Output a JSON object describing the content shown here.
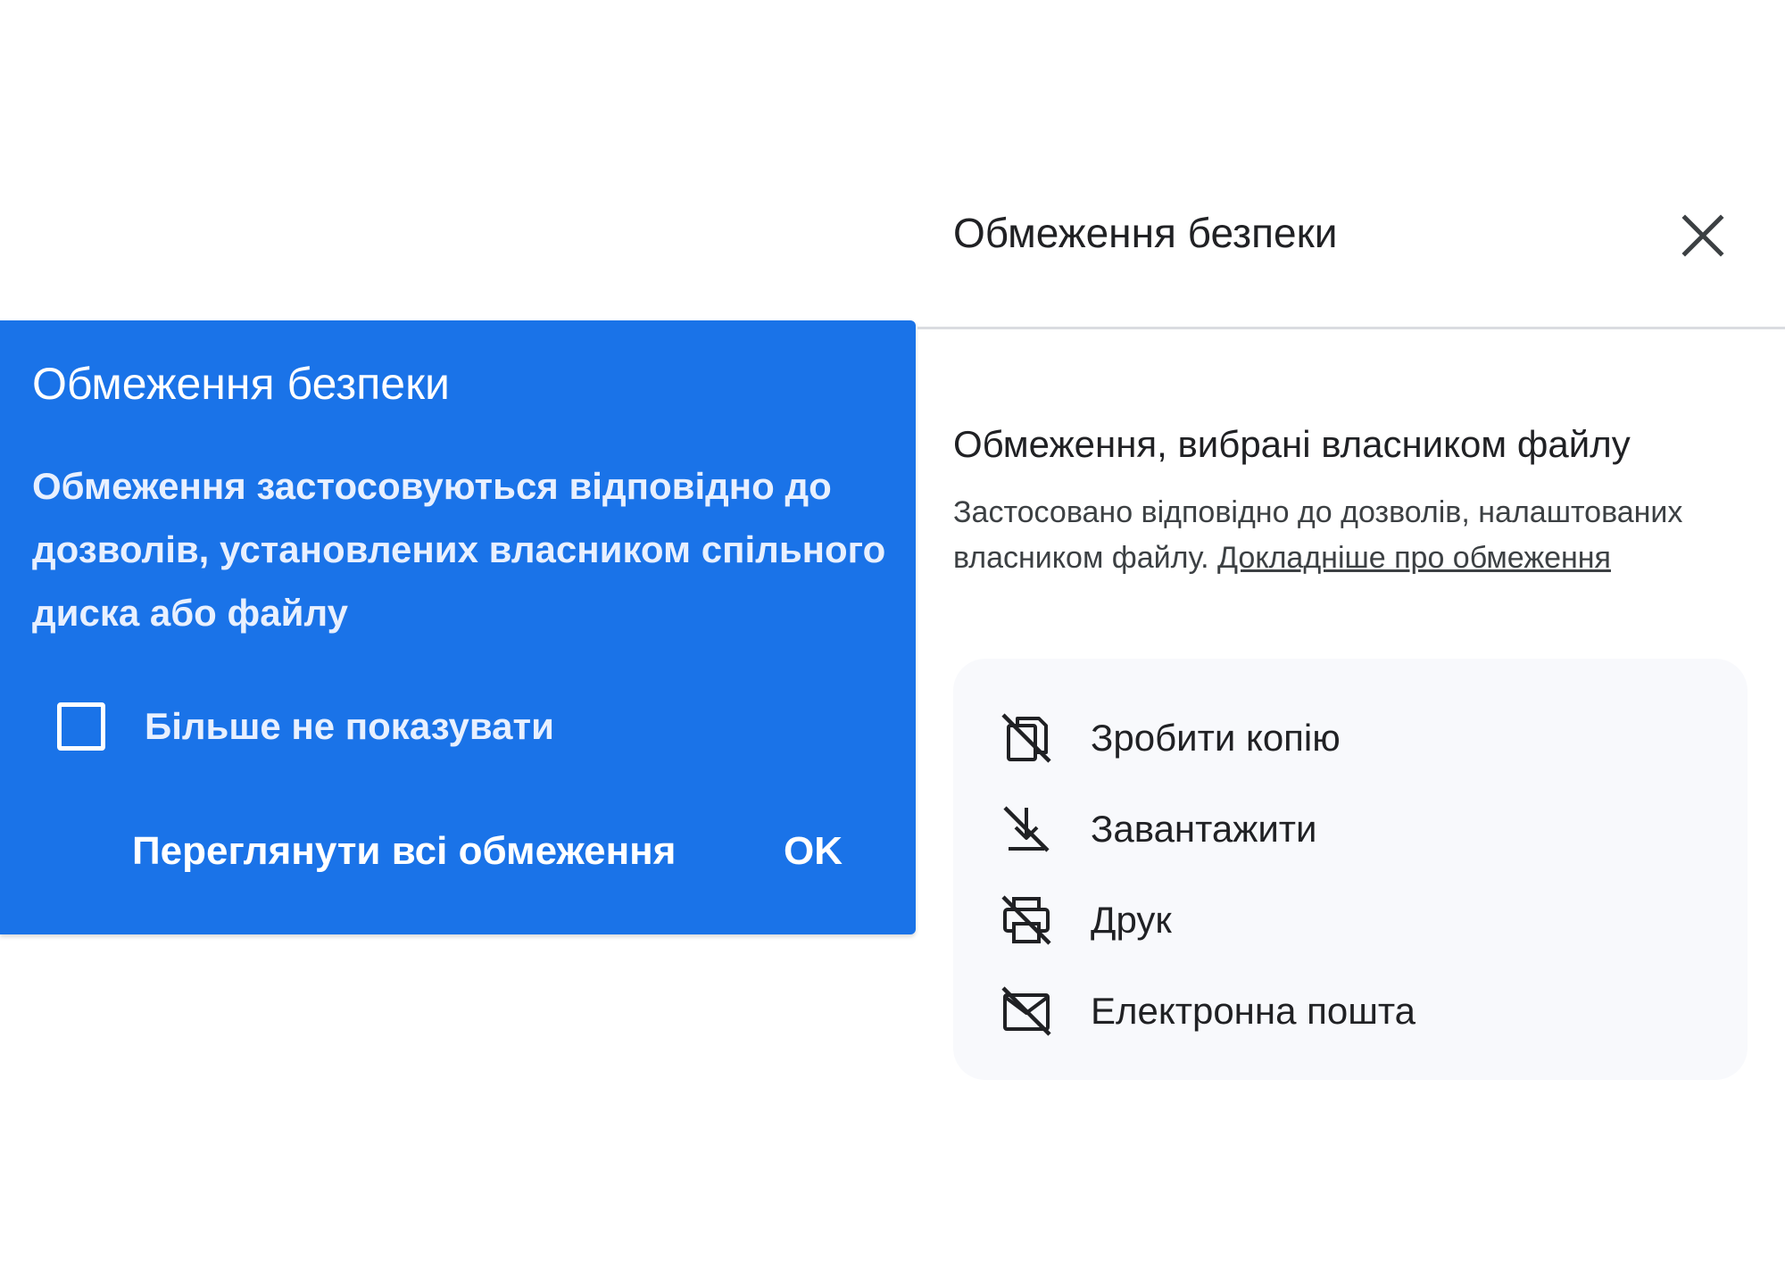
{
  "popup": {
    "title": "Обмеження безпеки",
    "body": "Обмеження застосовуються відповідно до дозволів, установлених власником спільного диска або файлу",
    "checkbox_label": "Більше не показувати",
    "checkbox_checked": false,
    "view_all_label": "Переглянути всі обмеження",
    "ok_label": "OK",
    "background_color": "#1a73e8"
  },
  "panel": {
    "title": "Обмеження безпеки",
    "close_icon": "close-icon",
    "subheading": "Обмеження, вибрані власником файлу",
    "description": "Застосовано відповідно до дозволів, налаштованих власником файлу.",
    "link_text": "Докладніше про обмеження",
    "restrictions": [
      {
        "label": "Зробити копію",
        "icon": "no-copy-icon"
      },
      {
        "label": "Завантажити",
        "icon": "no-download-icon"
      },
      {
        "label": "Друк",
        "icon": "no-print-icon"
      },
      {
        "label": "Електронна пошта",
        "icon": "no-email-icon"
      }
    ]
  }
}
